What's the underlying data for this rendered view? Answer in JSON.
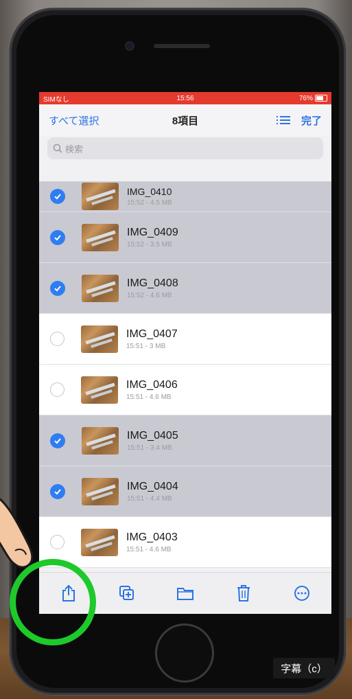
{
  "status_bar": {
    "carrier": "SIMなし",
    "time": "15:56",
    "battery": "76%"
  },
  "nav": {
    "select_all": "すべて選択",
    "title": "8項目",
    "done": "完了"
  },
  "search": {
    "placeholder": "検索"
  },
  "files": [
    {
      "name": "IMG_0410",
      "meta": "15:52 - 4.5 MB",
      "selected": true
    },
    {
      "name": "IMG_0409",
      "meta": "15:52 - 3.5 MB",
      "selected": true
    },
    {
      "name": "IMG_0408",
      "meta": "15:52 - 4.6 MB",
      "selected": true
    },
    {
      "name": "IMG_0407",
      "meta": "15:51 - 3 MB",
      "selected": false
    },
    {
      "name": "IMG_0406",
      "meta": "15:51 - 4.6 MB",
      "selected": false
    },
    {
      "name": "IMG_0405",
      "meta": "15:51 - 3.4 MB",
      "selected": true
    },
    {
      "name": "IMG_0404",
      "meta": "15:51 - 4.4 MB",
      "selected": true
    },
    {
      "name": "IMG_0403",
      "meta": "15:51 - 4.6 MB",
      "selected": false
    }
  ],
  "toolbar": [
    "share-icon",
    "duplicate-icon",
    "folder-icon",
    "trash-icon",
    "more-icon"
  ],
  "caption": "字幕（c）",
  "colors": {
    "accent": "#2b74e2",
    "status_bar": "#e53a2e",
    "highlight_ring": "#1ec92a",
    "selected_row": "#c9c9d2"
  }
}
